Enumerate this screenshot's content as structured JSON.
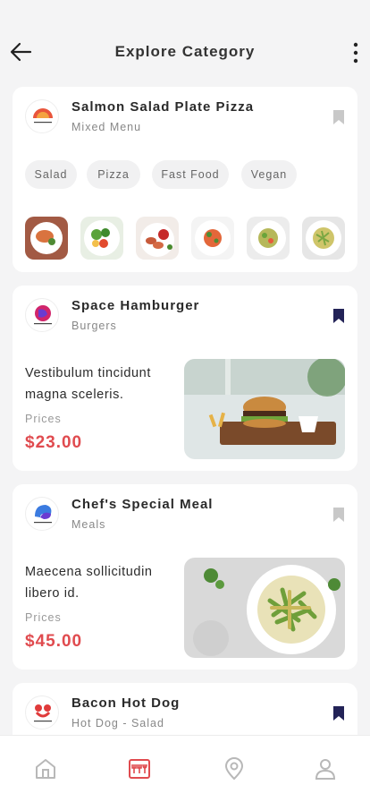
{
  "header": {
    "title": "Explore Category",
    "back_icon": "arrow-left-icon",
    "more_icon": "more-vertical-icon"
  },
  "featured": {
    "title": "Salmon Salad Plate Pizza",
    "subtitle": "Mixed Menu",
    "logo_text": "CateringGastro",
    "bookmarked": false,
    "chips": [
      "Salad",
      "Pizza",
      "Fast Food",
      "Vegan"
    ],
    "thumbnails": [
      "salmon-plate",
      "green-salad",
      "shrimp-dish",
      "pasta-dish",
      "pasta-green",
      "pasta-penne"
    ]
  },
  "items": [
    {
      "title": "Space Hamburger",
      "subtitle": "Burgers",
      "logo_text": "CateringGastro",
      "bookmarked": true,
      "description": "Vestibulum tincidunt magna sceleris.",
      "price_label": "Prices",
      "price": "$23.00"
    },
    {
      "title": "Chef's Special Meal",
      "subtitle": "Meals",
      "logo_text": "CateringGastro",
      "bookmarked": false,
      "description": "Maecena sollicitudin libero id.",
      "price_label": "Prices",
      "price": "$45.00"
    },
    {
      "title": "Bacon Hot Dog",
      "subtitle": "Hot Dog - Salad",
      "logo_text": "CateringGastro",
      "bookmarked": true
    }
  ],
  "nav": {
    "items": [
      "home-icon",
      "menu-icon",
      "location-icon",
      "profile-icon"
    ],
    "active_index": 1
  },
  "colors": {
    "accent": "#e04b4f",
    "bookmark_active": "#232357",
    "bookmark_inactive": "#c8c8c8",
    "background": "#f4f4f5"
  }
}
